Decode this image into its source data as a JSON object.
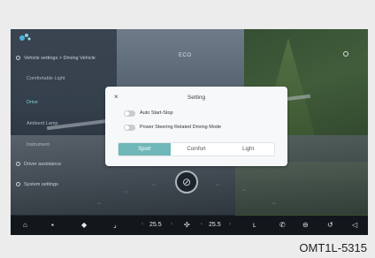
{
  "screen": {
    "mode_label": "ECO",
    "menu": [
      {
        "label": "Vehicle settings > Driving Vehicle",
        "selected": false
      },
      {
        "label": "Comfortable Light",
        "selected": false
      },
      {
        "label": "Drive",
        "selected": true
      },
      {
        "label": "Ambient Lamp",
        "selected": false
      },
      {
        "label": "Instrument",
        "selected": false
      },
      {
        "label": "Driver assistance",
        "selected": false
      },
      {
        "label": "System settings",
        "selected": false
      }
    ]
  },
  "dialog": {
    "title": "Setting",
    "close_icon": "×",
    "options": [
      {
        "label": "Auto Start-Stop",
        "on": false
      },
      {
        "label": "Power Steering Related Driving Mode",
        "on": false
      }
    ],
    "modes": [
      "Sport",
      "Comfort",
      "Light"
    ],
    "active_mode": "Sport",
    "accent_color": "#6fb7b8"
  },
  "bottom_bar": {
    "temp_left": "25.5",
    "temp_right": "25.5",
    "icons": [
      "home-icon",
      "grid-icon",
      "car-icon",
      "seat-icon",
      "fan-icon",
      "seat-heat-icon",
      "phone-icon",
      "defrost-icon",
      "recirculation-icon",
      "volume-icon"
    ]
  },
  "caption": "OMT1L-5315"
}
